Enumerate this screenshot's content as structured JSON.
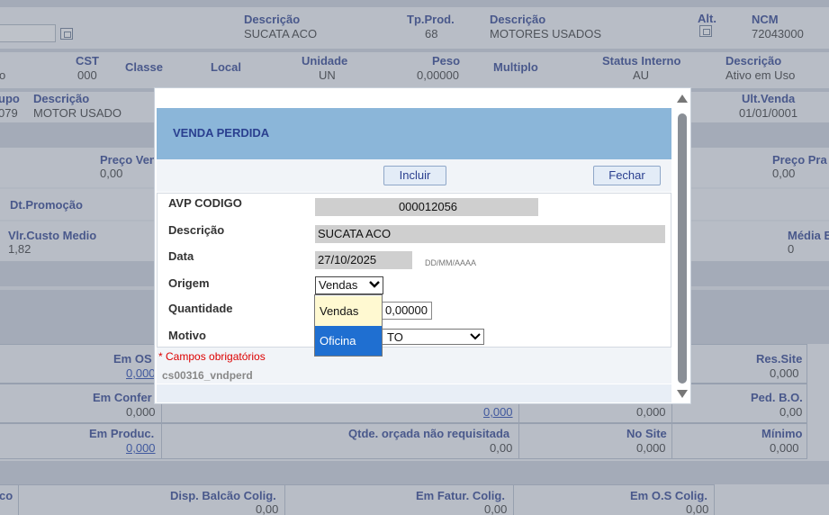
{
  "background": {
    "row1": {
      "descricao_label": "Descrição",
      "descricao_value": "SUCATA ACO",
      "tpprod_label": "Tp.Prod.",
      "tpprod_value": "68",
      "descricao2_label": "Descrição",
      "descricao2_value": "MOTORES USADOS",
      "alt_label": "Alt.",
      "ncm_label": "NCM",
      "ncm_value": "72043000"
    },
    "row2": {
      "o_value": "o",
      "cst_label": "CST",
      "cst_value": "000",
      "classe_label": "Classe",
      "local_label": "Local",
      "unidade_label": "Unidade",
      "unidade_value": "UN",
      "peso_label": "Peso",
      "peso_value": "0,00000",
      "multiplo_label": "Multiplo",
      "status_label": "Status Interno",
      "status_value": "AU",
      "descricao3_label": "Descrição",
      "descricao3_value": "Ativo em Uso"
    },
    "row3": {
      "grupo_label": "upo",
      "grupo_value": "079",
      "descricao_label": "Descrição",
      "descricao_value": "MOTOR USADO",
      "ultvenda_label": "Ult.Venda",
      "ultvenda_value": "01/01/0001"
    },
    "row4": {
      "preco_ven_label": "Preço Ven",
      "preco_ven_value": "0,00",
      "preco_pra_label": "Preço Pra",
      "preco_pra_value": "0,00"
    },
    "row5": {
      "dtpromocao_label": "Dt.Promoção"
    },
    "row6": {
      "vlrcusto_label": "Vlr.Custo Medio",
      "vlrcusto_value": "1,82",
      "media_label": "Média E",
      "media_value": "0"
    },
    "row7": {
      "emos_label": "Em OS",
      "emos_value": "0,000",
      "ressite_label": "Res.Site",
      "ressite_value": "0,000"
    },
    "row8": {
      "emconfer_label": "Em Confer",
      "emconfer_value": "0,000",
      "mid_link": "0,000",
      "mid_value": "0,000",
      "pedbo_label": "Ped. B.O.",
      "pedbo_value": "0,00"
    },
    "row9": {
      "emproduc_label": "Em Produc.",
      "emproduc_value": "0,000",
      "qtde_label": "Qtde. orçada não requisitada",
      "qtde_value": "0,00",
      "nosite_label": "No Site",
      "nosite_value": "0,000",
      "minimo_label": "Mínimo",
      "minimo_value": "0,000"
    },
    "row10": {
      "co_label": "co",
      "disp_label": "Disp. Balcão Colig.",
      "disp_value": "0,00",
      "emfatur_label": "Em Fatur. Colig.",
      "emfatur_value": "0,00",
      "emos_colig_label": "Em O.S Colig.",
      "emos_colig_value": "0,00"
    }
  },
  "modal": {
    "title": "VENDA PERDIDA",
    "incluir_label": "Incluir",
    "fechar_label": "Fechar",
    "fields": {
      "avp_label": "AVP CODIGO",
      "avp_value": "000012056",
      "descricao_label": "Descrição",
      "descricao_value": "SUCATA ACO",
      "data_label": "Data",
      "data_value": "27/10/2025",
      "data_hint": "DD/MM/AAAA",
      "origem_label": "Origem",
      "origem_value": "Vendas",
      "quantidade_label": "Quantidade",
      "quantidade_value": "0,00000",
      "motivo_label": "Motivo",
      "motivo_value": "TO"
    },
    "required_note": "* Campos obrigatórios",
    "form_code": "cs00316_vndperd",
    "dropdown_options": [
      "Vendas",
      "Oficina"
    ]
  },
  "colors": {
    "header_bg": "#8bb6d9",
    "label_blue": "#2a3f8f",
    "highlight": "#1f6fd1",
    "required_red": "#dd0000"
  }
}
